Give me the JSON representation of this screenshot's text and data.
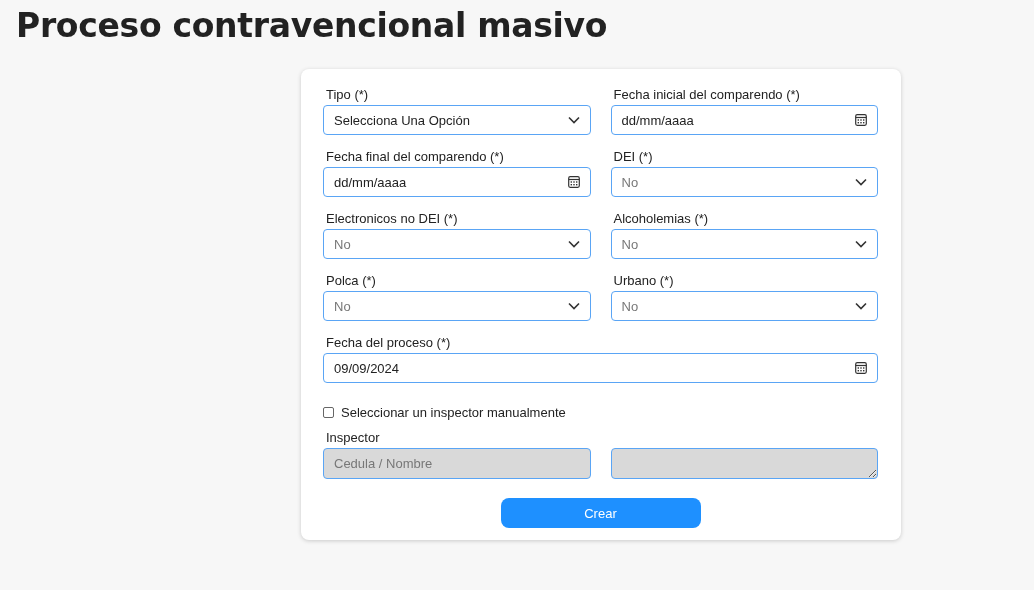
{
  "title": "Proceso contravencional masivo",
  "fields": [
    {
      "label": "Tipo (*)",
      "kind": "select",
      "value": "Selecciona Una Opción",
      "dimmed": false,
      "wide": false
    },
    {
      "label": "Fecha inicial del comparendo (*)",
      "kind": "date",
      "value": "dd/mm/aaaa",
      "dimmed": false,
      "wide": false
    },
    {
      "label": "Fecha final del comparendo (*)",
      "kind": "date",
      "value": "dd/mm/aaaa",
      "dimmed": false,
      "wide": false
    },
    {
      "label": "DEI (*)",
      "kind": "select",
      "value": "No",
      "dimmed": true,
      "wide": false
    },
    {
      "label": "Electronicos no DEI (*)",
      "kind": "select",
      "value": "No",
      "dimmed": true,
      "wide": false
    },
    {
      "label": "Alcoholemias (*)",
      "kind": "select",
      "value": "No",
      "dimmed": true,
      "wide": false
    },
    {
      "label": "Polca (*)",
      "kind": "select",
      "value": "No",
      "dimmed": true,
      "wide": false
    },
    {
      "label": "Urbano (*)",
      "kind": "select",
      "value": "No",
      "dimmed": true,
      "wide": false
    },
    {
      "label": "Fecha del proceso (*)",
      "kind": "date",
      "value": "09/09/2024",
      "dimmed": false,
      "wide": true
    }
  ],
  "manual_inspector": {
    "label": "Seleccionar un inspector manualmente",
    "checked": false
  },
  "inspector": {
    "label": "Inspector",
    "search": {
      "placeholder": "Cedula / Nombre",
      "disabled": true
    },
    "details": {
      "disabled": true
    }
  },
  "submit": "Crear"
}
